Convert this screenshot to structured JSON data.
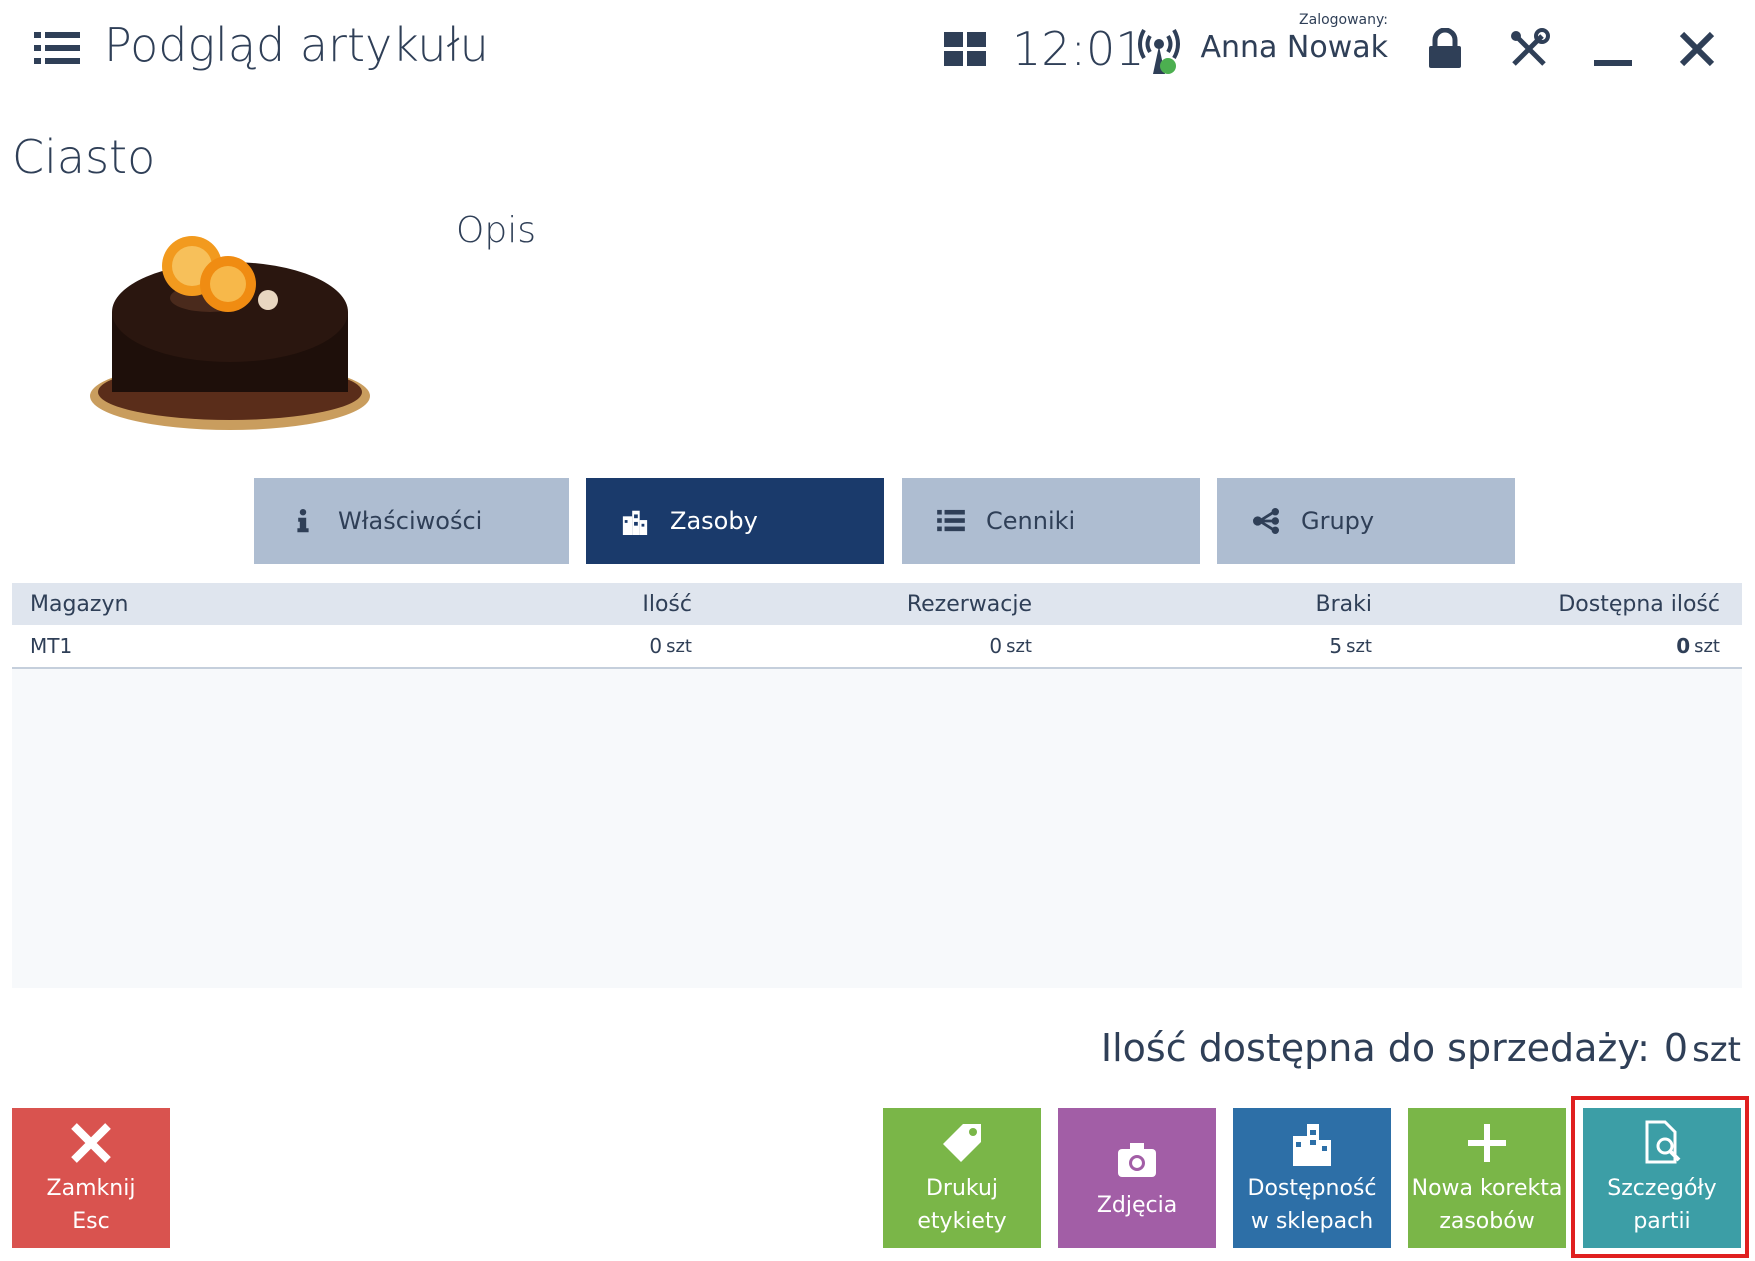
{
  "header": {
    "title": "Podgląd artykułu",
    "time": "12:01",
    "logged_label": "Zalogowany:",
    "user": "Anna Nowak"
  },
  "article": {
    "name": "Ciasto",
    "description_label": "Opis"
  },
  "tabs": [
    {
      "label": "Właściwości",
      "icon": "info-icon"
    },
    {
      "label": "Zasoby",
      "icon": "buildings-icon",
      "active": true
    },
    {
      "label": "Cenniki",
      "icon": "list-icon"
    },
    {
      "label": "Grupy",
      "icon": "share-icon"
    }
  ],
  "table": {
    "headers": [
      "Magazyn",
      "Ilość",
      "Rezerwacje",
      "Braki",
      "Dostępna ilość"
    ],
    "rows": [
      {
        "warehouse": "MT1",
        "qty": "0",
        "reservations": "0",
        "shortages": "5",
        "available": "0",
        "unit": "szt"
      }
    ]
  },
  "sale": {
    "label": "Ilość dostępna do sprzedaży:",
    "value": "0",
    "unit": "szt"
  },
  "buttons": {
    "close_line1": "Zamknij",
    "close_line2": "Esc",
    "print_line1": "Drukuj",
    "print_line2": "etykiety",
    "photos": "Zdjęcia",
    "avail_line1": "Dostępność",
    "avail_line2": "w sklepach",
    "correct_line1": "Nowa korekta",
    "correct_line2": "zasobów",
    "batch_line1": "Szczegóły",
    "batch_line2": "partii"
  },
  "colors": {
    "active_tab": "#1a3a6b",
    "inactive_tab": "#aebdd1",
    "close": "#d9534f",
    "green": "#7ab648",
    "purple": "#a25ea6",
    "blue": "#2d6fa7",
    "teal": "#3c9ea6",
    "highlight": "#e02020"
  }
}
